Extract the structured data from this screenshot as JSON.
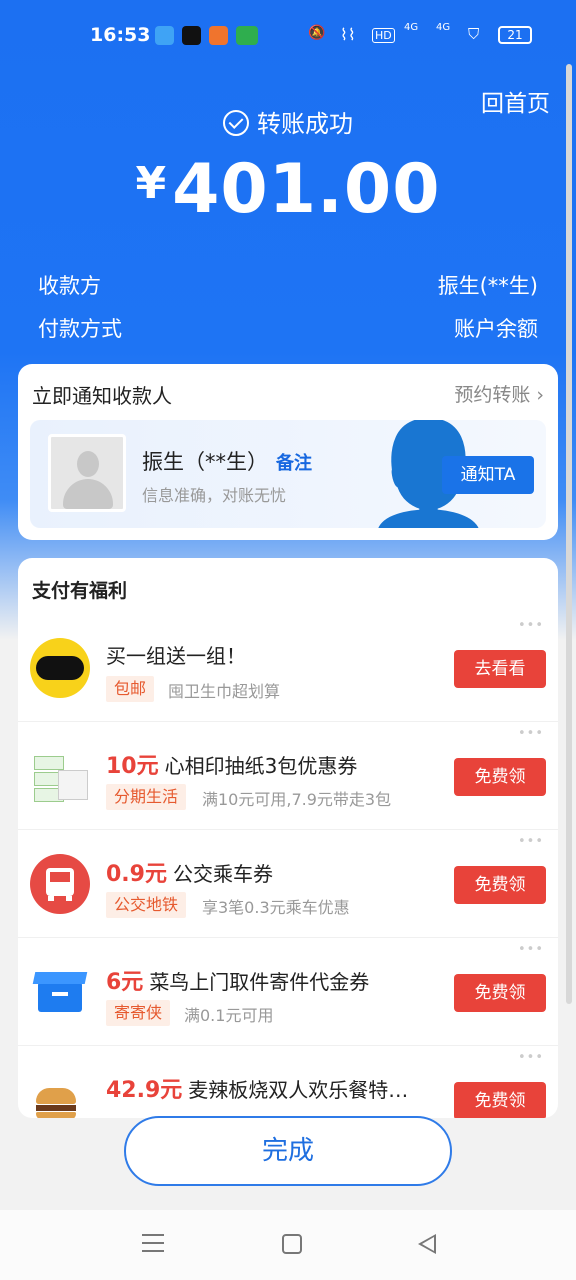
{
  "status_bar": {
    "time": "16:53",
    "battery": "21",
    "apps": [
      {
        "name": "files-app-icon",
        "color": "#3fa3f5"
      },
      {
        "name": "tiktok-app-icon",
        "color": "#111111"
      },
      {
        "name": "calendar-app-icon",
        "color": "#f0742d"
      },
      {
        "name": "oppo-app-icon",
        "color": "#2fae4e"
      }
    ],
    "signal_labels": [
      "HD",
      "4G",
      "4G"
    ]
  },
  "header": {
    "home_link": "回首页",
    "status_text": "转账成功",
    "currency": "¥",
    "amount": "401.00",
    "payee_label": "收款方",
    "payee_value": "振生(**生)",
    "method_label": "付款方式",
    "method_value": "账户余额"
  },
  "notify": {
    "title": "立即通知收款人",
    "schedule_link": "预约转账",
    "payee_name": "振生（**生）",
    "remark": "备注",
    "subtitle": "信息准确，对账无忧",
    "button": "通知TA"
  },
  "benefits": {
    "title": "支付有福利",
    "items": [
      {
        "price": "",
        "title": "买一组送一组！",
        "tag": "包邮",
        "desc": "囤卫生巾超划算",
        "button": "去看看",
        "logo_icon": "ziyoudian-logo-icon"
      },
      {
        "price": "10元",
        "title": "心相印抽纸3包优惠券",
        "tag": "分期生活",
        "desc": "满10元可用,7.9元带走3包",
        "button": "免费领",
        "logo_icon": "tissue-pack-icon"
      },
      {
        "price": "0.9元",
        "title": "公交乘车券",
        "tag": "公交地铁",
        "desc": "享3笔0.3元乘车优惠",
        "button": "免费领",
        "logo_icon": "bus-icon"
      },
      {
        "price": "6元",
        "title": "菜鸟上门取件寄件代金券",
        "tag": "寄寄侠",
        "desc": "满0.1元可用",
        "button": "免费领",
        "logo_icon": "parcel-box-icon"
      },
      {
        "price": "42.9元",
        "title": "麦辣板烧双人欢乐餐特…",
        "tag": "",
        "desc": "",
        "button": "免费领",
        "logo_icon": "burger-icon"
      }
    ]
  },
  "done_button": "完成",
  "colors": {
    "brand_blue": "#1c70f2",
    "red": "#e8433a",
    "tag_orange": "#e65a2f"
  }
}
